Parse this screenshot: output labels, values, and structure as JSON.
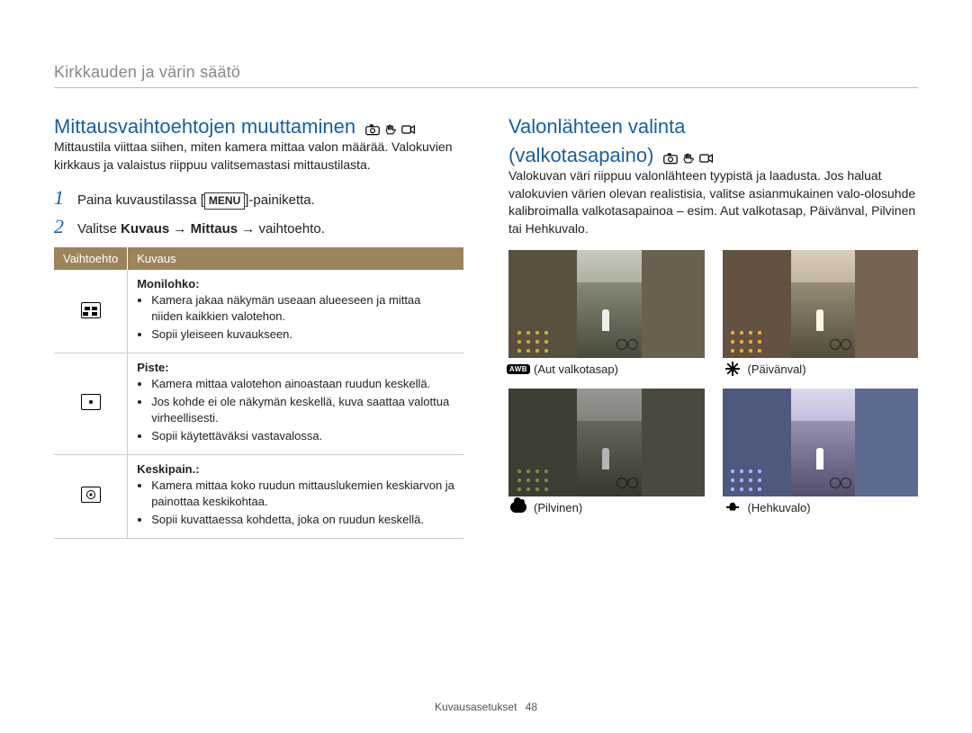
{
  "header": "Kirkkauden ja värin säätö",
  "left": {
    "title": "Mittausvaihtoehtojen muuttaminen",
    "intro": "Mittaustila viittaa siihen, miten kamera mittaa valon määrää. Valokuvien kirkkaus ja valaistus riippuu valitsemastasi mittaustilasta.",
    "steps": [
      {
        "num": "1",
        "pre": "Paina kuvaustilassa [",
        "menu": "MENU",
        "post": "]-painiketta."
      },
      {
        "num": "2",
        "textA": "Valitse ",
        "bold1": "Kuvaus",
        "arrow1": " → ",
        "bold2": "Mittaus",
        "arrow2": " → vaihtoehto."
      }
    ],
    "table": {
      "col1": "Vaihtoehto",
      "col2": "Kuvaus",
      "rows": [
        {
          "icon": "multi",
          "name": "Monilohko:",
          "bullets": [
            "Kamera jakaa näkymän useaan alueeseen ja mittaa niiden kaikkien valotehon.",
            "Sopii yleiseen kuvaukseen."
          ]
        },
        {
          "icon": "spot",
          "name": "Piste:",
          "bullets": [
            "Kamera mittaa valotehon ainoastaan ruudun keskellä.",
            "Jos kohde ei ole näkymän keskellä, kuva saattaa valottua virheellisesti.",
            "Sopii käytettäväksi vastavalossa."
          ]
        },
        {
          "icon": "center",
          "name": "Keskipain.:",
          "bullets": [
            "Kamera mittaa koko ruudun mittauslukemien keskiarvon ja painottaa keskikohtaa.",
            "Sopii kuvattaessa kohdetta, joka on ruudun keskellä."
          ]
        }
      ]
    }
  },
  "right": {
    "title1": "Valonlähteen valinta",
    "title2": "(valkotasapaino)",
    "intro": "Valokuvan väri riippuu valonlähteen tyypistä ja laadusta. Jos haluat valokuvien värien olevan realistisia, valitse asianmukainen valo-olosuhde kalibroimalla valkotasapainoa – esim. Aut valkotasap, Päivänval, Pilvinen tai Hehkuvalo.",
    "wb": [
      {
        "icon": "awb",
        "label": "(Aut valkotasap)"
      },
      {
        "icon": "sun",
        "label": "(Päivänval)"
      },
      {
        "icon": "cloud",
        "label": "(Pilvinen)"
      },
      {
        "icon": "bulb",
        "label": "(Hehkuvalo)"
      }
    ]
  },
  "footer": {
    "section": "Kuvausasetukset",
    "page": "48"
  },
  "awb_text": "AWB"
}
